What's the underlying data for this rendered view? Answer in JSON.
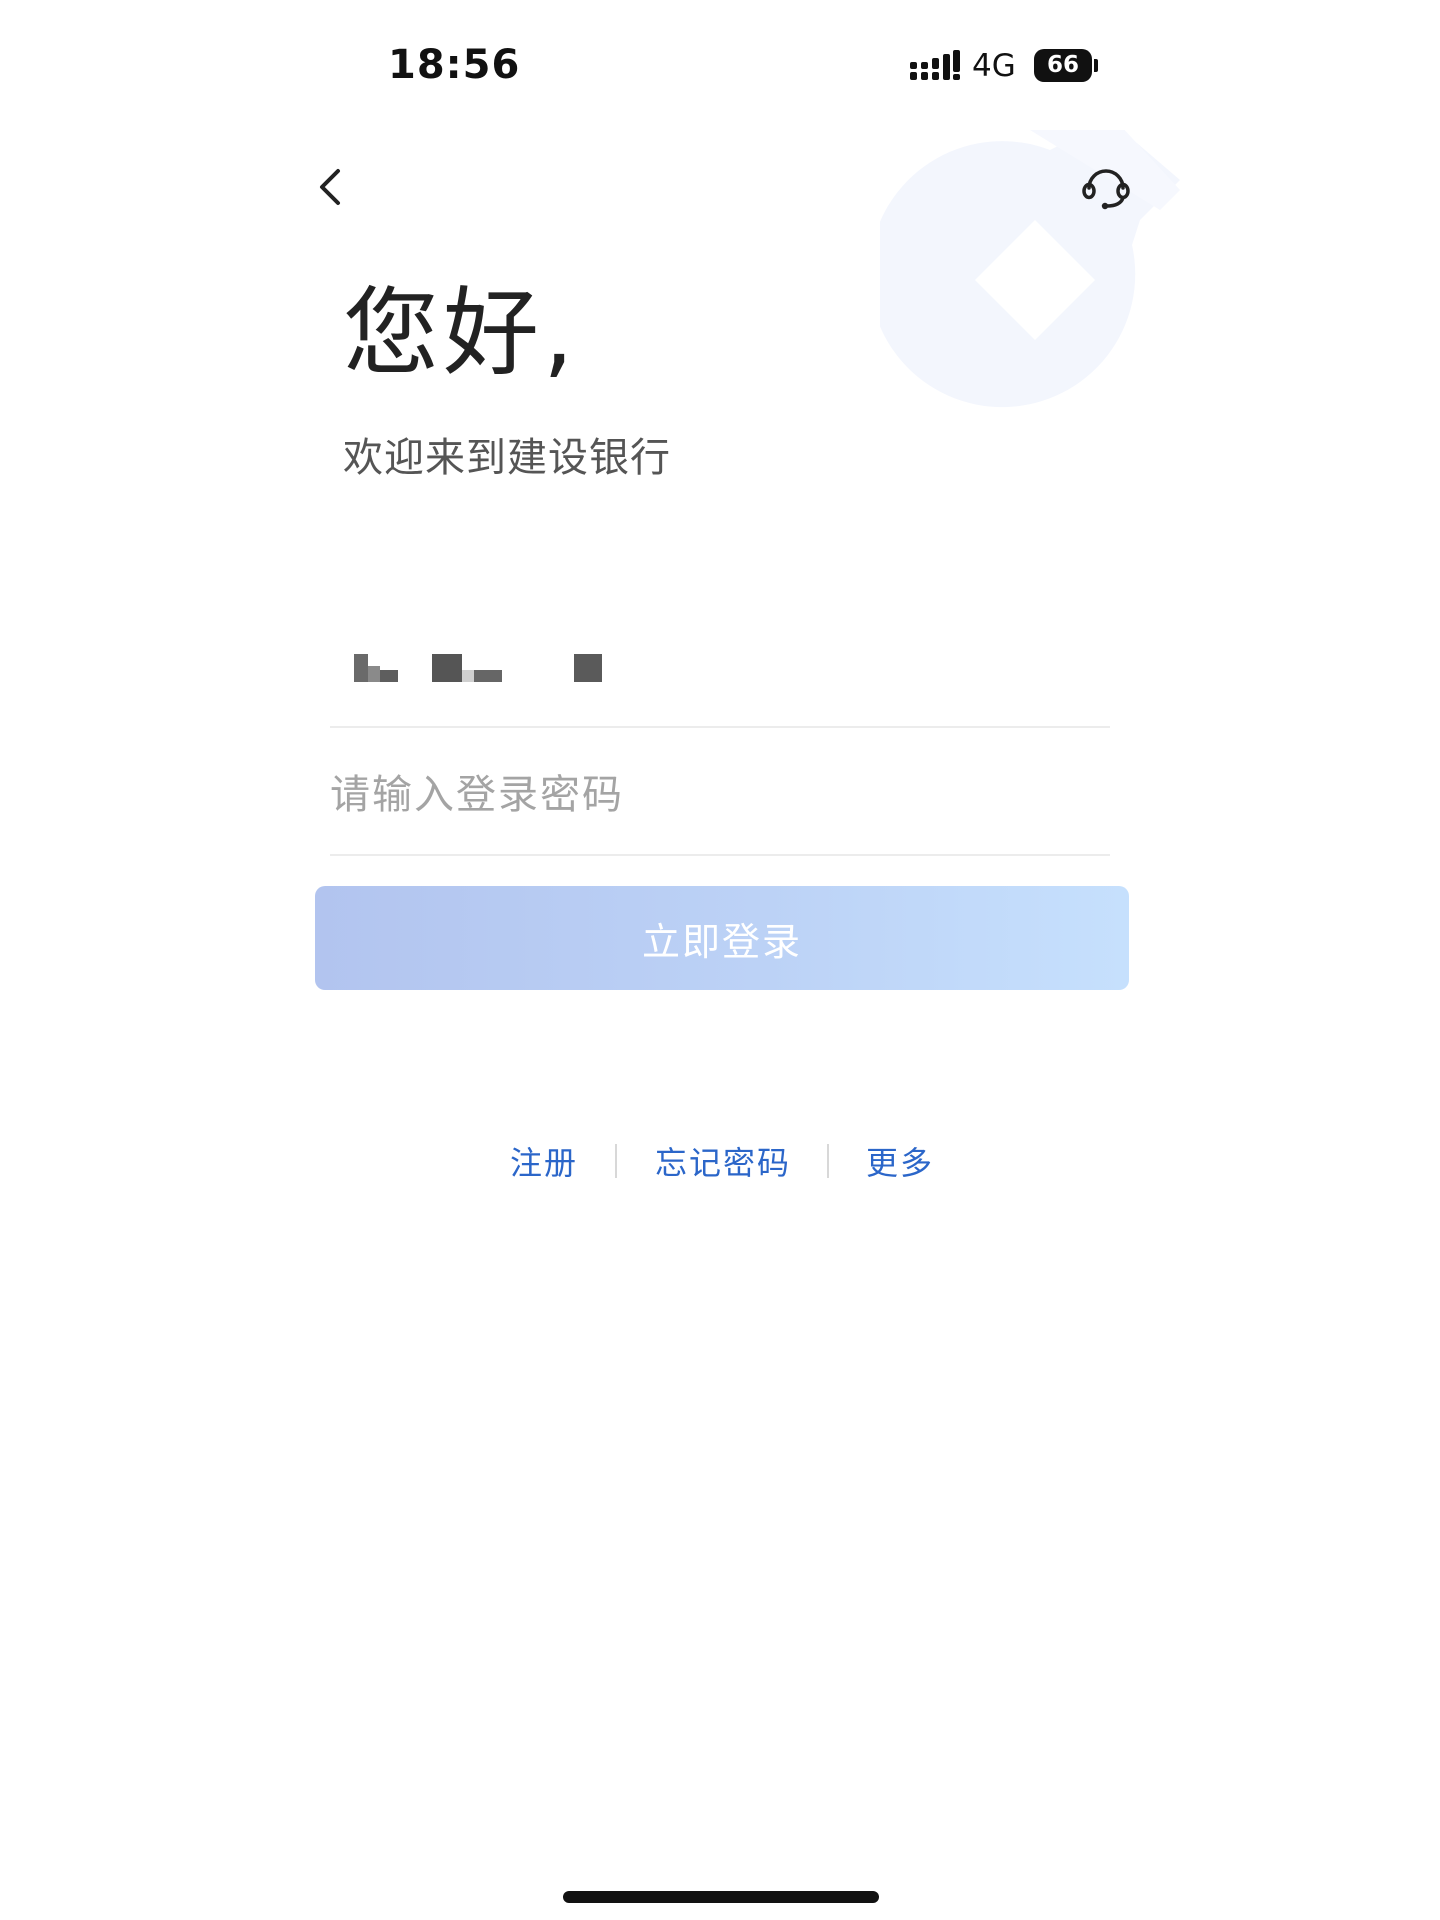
{
  "status_bar": {
    "time": "18:56",
    "network": "4G",
    "battery": "66"
  },
  "header": {
    "back_icon": "chevron-left-icon",
    "service_icon": "headset-icon",
    "logo": "ccb-logo-watermark"
  },
  "greeting": {
    "title": "您好,",
    "subtitle": "欢迎来到建设银行"
  },
  "form": {
    "account_value": "",
    "password_placeholder": "请输入登录密码",
    "login_label": "立即登录"
  },
  "links": {
    "register": "注册",
    "forgot_password": "忘记密码",
    "more": "更多"
  },
  "colors": {
    "link": "#2b66c9",
    "button_start": "#b2c4ef",
    "button_end": "#c6e0fd",
    "watermark": "#f3f6fd"
  }
}
